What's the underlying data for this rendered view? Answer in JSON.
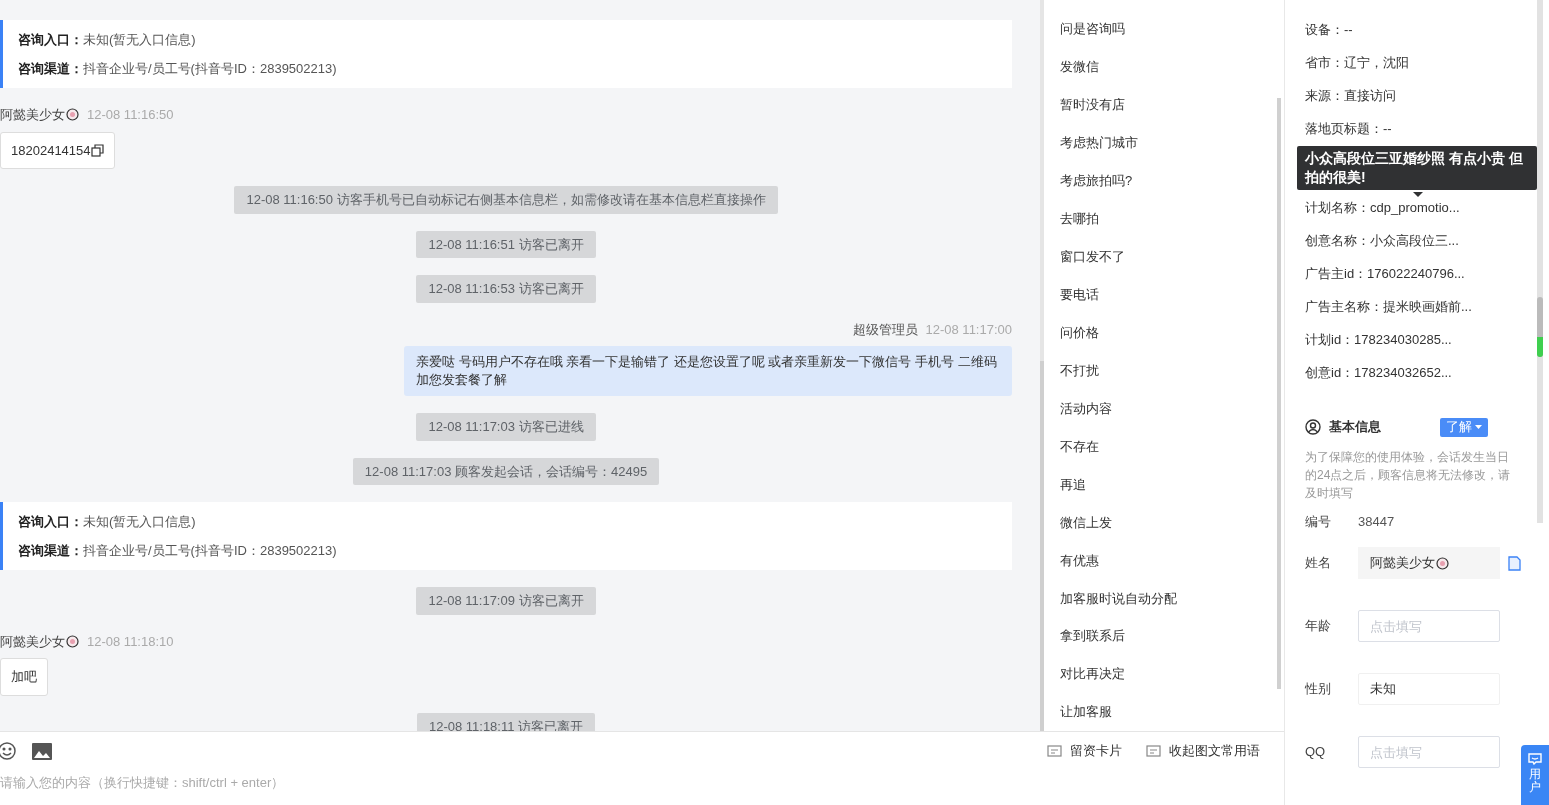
{
  "chat": {
    "messages": [
      {
        "kind": "info",
        "entry_label": "咨询入口：",
        "entry_value": "未知(暂无入口信息)",
        "channel_label": "咨询渠道：",
        "channel_value": "抖音企业号/员工号(抖音号ID：2839502213)"
      },
      {
        "kind": "visitor",
        "name": "阿懿美少女",
        "time": "12-08 11:16:50",
        "text": "18202414154",
        "copyable": true
      },
      {
        "kind": "system",
        "text": "12-08 11:16:50 访客手机号已自动标记右侧基本信息栏，如需修改请在基本信息栏直接操作"
      },
      {
        "kind": "system",
        "text": "12-08 11:16:51 访客已离开"
      },
      {
        "kind": "system",
        "text": "12-08 11:16:53 访客已离开"
      },
      {
        "kind": "agent",
        "name": "超级管理员",
        "time": "12-08 11:17:00",
        "text": "亲爱哒 号码用户不存在哦 亲看一下是输错了 还是您设置了呢 或者亲重新发一下微信号 手机号 二维码加您发套餐了解"
      },
      {
        "kind": "system",
        "text": "12-08 11:17:03 访客已进线"
      },
      {
        "kind": "system",
        "text": "12-08 11:17:03 顾客发起会话，会话编号：42495"
      },
      {
        "kind": "info",
        "entry_label": "咨询入口：",
        "entry_value": "未知(暂无入口信息)",
        "channel_label": "咨询渠道：",
        "channel_value": "抖音企业号/员工号(抖音号ID：2839502213)"
      },
      {
        "kind": "system",
        "text": "12-08 11:17:09 访客已离开"
      },
      {
        "kind": "visitor",
        "name": "阿懿美少女",
        "time": "12-08 11:18:10",
        "text": "加吧",
        "copyable": false
      },
      {
        "kind": "system",
        "text": "12-08 11:18:11 访客已离开"
      }
    ],
    "input": {
      "placeholder": "请输入您的内容（换行快捷键：shift/ctrl + enter）"
    }
  },
  "quick_replies": [
    "问是咨询吗",
    "发微信",
    "暂时没有店",
    "考虑热门城市",
    "考虑旅拍吗?",
    "去哪拍",
    "窗口发不了",
    "要电话",
    "问价格",
    "不打扰",
    "活动内容",
    "不存在",
    "再追",
    "微信上发",
    "有优惠",
    "加客服时说自动分配",
    "拿到联系后",
    "对比再决定",
    "让加客服"
  ],
  "actions": [
    "留资卡片",
    "收起图文常用语"
  ],
  "visit_info": {
    "rows": [
      "设备：--",
      "省市：辽宁，沈阳",
      "来源：直接访问",
      "落地页标题：--"
    ],
    "tooltip": "小众高段位三亚婚纱照 有点小贵 但拍的很美!",
    "rows_after": [
      "计划名称：cdp_promotio...",
      "创意名称：小众高段位三...",
      "广告主id：176022240796...",
      "广告主名称：提米映画婚前...",
      "计划id：178234030285...",
      "创意id：178234032652..."
    ]
  },
  "basic_info": {
    "title": "基本信息",
    "learn_button": "了解",
    "notice": "为了保障您的使用体验，会话发生当日的24点之后，顾客信息将无法修改，请及时填写",
    "fields": [
      {
        "kind": "text",
        "label": "编号",
        "value": "38447"
      },
      {
        "kind": "name",
        "label": "姓名",
        "value": "阿懿美少女"
      },
      {
        "kind": "input",
        "label": "年龄",
        "placeholder": "点击填写"
      },
      {
        "kind": "select",
        "label": "性别",
        "value": "未知"
      },
      {
        "kind": "input",
        "label": "QQ",
        "placeholder": "点击填写"
      }
    ]
  },
  "float_button": {
    "label": "用户"
  }
}
